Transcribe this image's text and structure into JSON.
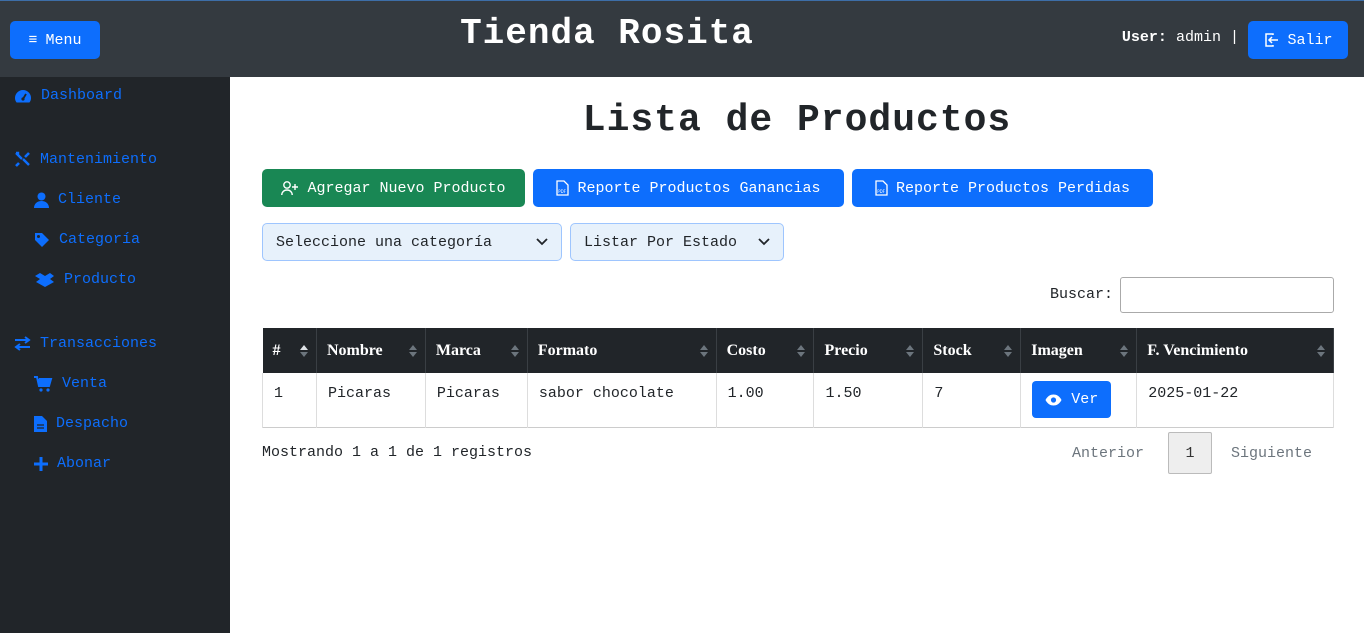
{
  "header": {
    "menu_label": "Menu",
    "brand": "Tienda Rosita",
    "user_prefix": "User:",
    "user_name": "admin",
    "separator": "|",
    "logout_label": "Salir"
  },
  "sidebar": {
    "items": [
      {
        "label": "Dashboard",
        "icon": "gauge-icon"
      },
      {
        "label": "Mantenimiento",
        "icon": "tools-icon"
      },
      {
        "label": "Cliente",
        "icon": "user-icon"
      },
      {
        "label": "Categoría",
        "icon": "tag-icon"
      },
      {
        "label": "Producto",
        "icon": "boxes-icon"
      },
      {
        "label": "Transacciones",
        "icon": "exchange-icon"
      },
      {
        "label": "Venta",
        "icon": "cart-icon"
      },
      {
        "label": "Despacho",
        "icon": "file-icon"
      },
      {
        "label": "Abonar",
        "icon": "plus-icon"
      }
    ]
  },
  "main": {
    "title": "Lista de Productos",
    "buttons": {
      "add_product": "Agregar Nuevo Producto",
      "report_gains": "Reporte Productos Ganancias",
      "report_losses": "Reporte Productos Perdidas"
    },
    "filters": {
      "category_select": "Seleccione una categoría",
      "state_select": "Listar Por Estado"
    },
    "search_label": "Buscar:",
    "search_value": "",
    "table": {
      "columns": [
        "#",
        "Nombre",
        "Marca",
        "Formato",
        "Costo",
        "Precio",
        "Stock",
        "Imagen",
        "F. Vencimiento"
      ],
      "rows": [
        {
          "num": "1",
          "nombre": "Picaras",
          "marca": "Picaras",
          "formato": "sabor chocolate",
          "costo": "1.00",
          "precio": "1.50",
          "stock": "7",
          "imagen_btn": "Ver",
          "vencimiento": "2025-01-22"
        }
      ]
    },
    "info": "Mostrando 1 a 1 de 1 registros",
    "pagination": {
      "prev": "Anterior",
      "current": "1",
      "next": "Siguiente"
    }
  },
  "colors": {
    "primary": "#0d6efd",
    "success": "#198754",
    "dark": "#212529",
    "header": "#343a40"
  }
}
